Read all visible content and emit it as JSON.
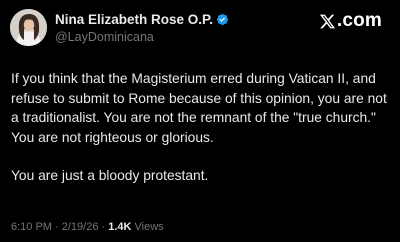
{
  "author": {
    "display_name": "Nina Elizabeth Rose O.P.",
    "handle": "@LayDominicana",
    "verified": true
  },
  "brand": {
    "label": ".com",
    "icon": "x-logo-icon"
  },
  "post": {
    "paragraph_1": "If you think that the Magisterium erred during Vatican II, and refuse to submit to Rome because of this opinion, you are not a traditionalist. You are not the remnant of the \"true church.\" You are not righteous or glorious.",
    "paragraph_2": "You are just a bloody protestant."
  },
  "meta": {
    "time": "6:10 PM",
    "separator_1": " · ",
    "date": "2/19/26",
    "separator_2": " · ",
    "views_count": "1.4K",
    "views_label": " Views"
  },
  "colors": {
    "background": "#000000",
    "text": "#e7e9ea",
    "secondary": "#71767b",
    "verified": "#1d9bf0"
  }
}
